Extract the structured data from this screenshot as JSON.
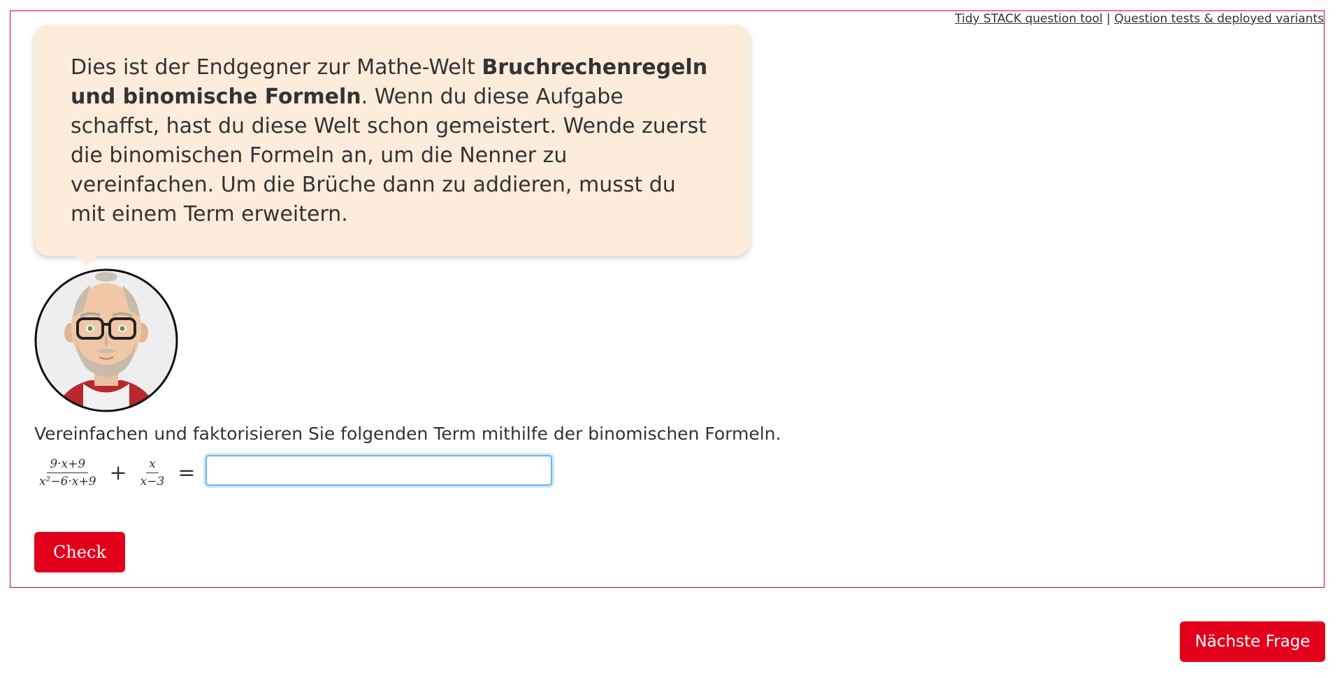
{
  "tool_links": {
    "tidy_tool": "Tidy STACK question tool",
    "separator": " | ",
    "tests": "Question tests & deployed variants"
  },
  "bubble": {
    "part1": "Dies ist der Endgegner zur Mathe-Welt ",
    "bold": "Bruchrechenregeln und binomische Formeln",
    "part2": ". Wenn du diese Aufgabe schaffst, hast du diese Welt schon gemeistert. Wende zuerst die binomischen Formeln an, um die Nenner zu vereinfachen. Um die Brüche dann zu addieren, musst du mit einem Term erweitern."
  },
  "question": {
    "instruction": "Vereinfachen und faktorisieren Sie folgenden Term mithilfe der binomischen Formeln.",
    "frac1_num": "9·x+9",
    "frac1_den": "x²−6·x+9",
    "plus": "+",
    "frac2_num": "x",
    "frac2_den": "x−3",
    "equals": "=",
    "answer_value": ""
  },
  "buttons": {
    "check": "Check",
    "next": "Nächste Frage"
  },
  "colors": {
    "accent": "#e3001b",
    "frame": "#d9001b",
    "bubble_bg": "#fdecdb",
    "input_focus": "#6cb5e6"
  }
}
